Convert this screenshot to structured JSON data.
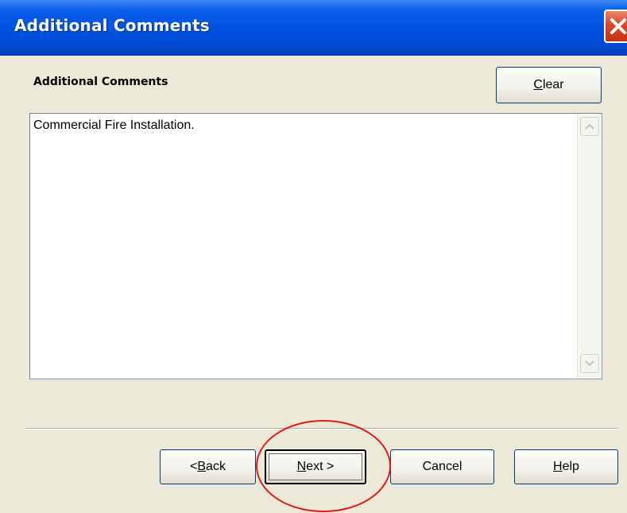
{
  "window": {
    "title": "Additional Comments"
  },
  "section": {
    "label": "Additional Comments"
  },
  "comments": {
    "value": "Commercial Fire Installation."
  },
  "buttons": {
    "clear_mnemonic": "C",
    "clear_rest": "lear",
    "back_prefix": "< ",
    "back_mnemonic": "B",
    "back_rest": "ack",
    "next_mnemonic": "N",
    "next_rest": "ext >",
    "cancel": "Cancel",
    "help_mnemonic": "H",
    "help_rest": "elp"
  },
  "colors": {
    "titlebar": "#0054e3",
    "dialog_bg": "#ece9d8",
    "close_red": "#d9482a",
    "highlight_circle": "#e21b1b"
  }
}
